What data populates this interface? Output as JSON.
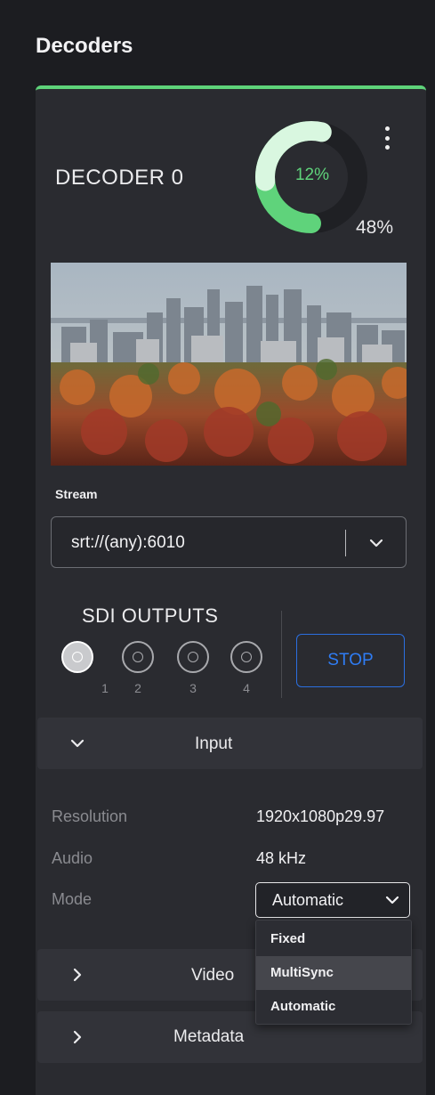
{
  "page": {
    "title": "Decoders"
  },
  "decoder": {
    "name": "DECODER 0",
    "gauge": {
      "inner_label": "12%",
      "outer_label": "48%",
      "inner_value": 0.12,
      "outer_value": 0.48
    },
    "accent_color": "#5ed37a"
  },
  "stream": {
    "label": "Stream",
    "value": "srt://(any):6010"
  },
  "sdi": {
    "title": "SDI OUTPUTS",
    "ports": [
      {
        "label": "1",
        "active": true
      },
      {
        "label": "2",
        "active": false
      },
      {
        "label": "3",
        "active": false
      },
      {
        "label": "4",
        "active": false
      }
    ],
    "stop_label": "STOP",
    "stop_color": "#2f7df5"
  },
  "input_section": {
    "title": "Input",
    "expanded": true,
    "rows": [
      {
        "label": "Resolution",
        "value": "1920x1080p29.97"
      },
      {
        "label": "Audio",
        "value": "48 kHz"
      },
      {
        "label": "Mode",
        "value": "Automatic"
      }
    ],
    "mode_options": [
      "Fixed",
      "MultiSync",
      "Automatic"
    ],
    "hovered_option": "MultiSync"
  },
  "video_section": {
    "title": "Video",
    "expanded": false
  },
  "metadata_section": {
    "title": "Metadata",
    "expanded": false
  }
}
